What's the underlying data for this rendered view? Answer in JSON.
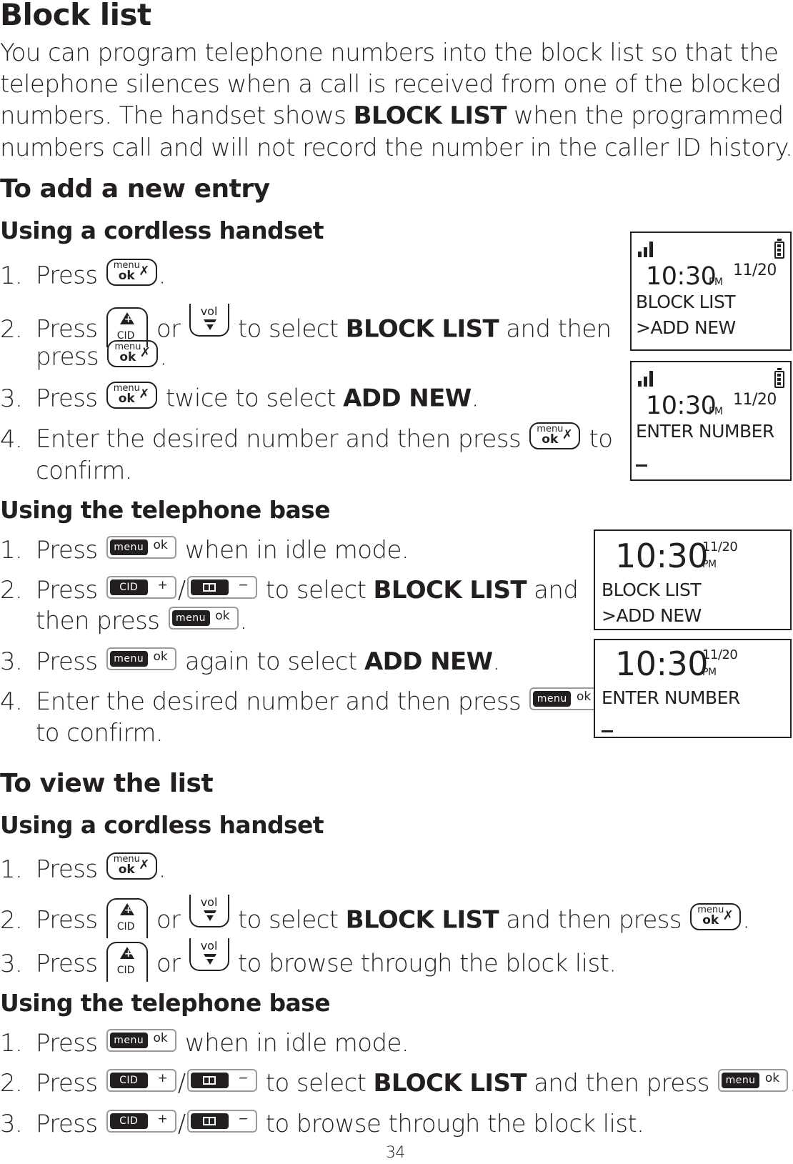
{
  "title": "Block list",
  "intro": [
    "You can program telephone numbers into the block list so that the",
    "telephone silences when a call is received from one of the blocked",
    "numbers. The handset shows ",
    "BLOCK LIST",
    " when the programmed",
    "numbers call and will not record the number in the caller ID history."
  ],
  "add_section": {
    "heading": "To add a new entry",
    "handset": {
      "heading": "Using a cordless handset",
      "steps": {
        "s1": {
          "num": "1.",
          "a": "Press ",
          "b": "."
        },
        "s2": {
          "num": "2.",
          "a": "Press ",
          "or": " or ",
          "c": " to select ",
          "bold": "BLOCK LIST",
          "d": " and then",
          "e": "press ",
          "f": "."
        },
        "s3": {
          "num": "3.",
          "a": "Press ",
          "b": " twice to select ",
          "bold": "ADD NEW",
          "c": "."
        },
        "s4": {
          "num": "4.",
          "a": "Enter the desired number and then press ",
          "b": " to",
          "c": "confirm."
        }
      }
    },
    "base": {
      "heading": "Using the telephone base",
      "steps": {
        "s1": {
          "num": "1.",
          "a": "Press ",
          "b": " when in idle mode."
        },
        "s2": {
          "num": "2.",
          "a": "Press ",
          "slash": "/",
          "c": " to select ",
          "bold": "BLOCK LIST",
          "d": " and",
          "e": "then press ",
          "f": "."
        },
        "s3": {
          "num": "3.",
          "a": "Press ",
          "b": " again to select ",
          "bold": "ADD NEW",
          "c": "."
        },
        "s4": {
          "num": "4.",
          "a": "Enter the desired number and then press ",
          "c": "to confirm."
        }
      }
    }
  },
  "view_section": {
    "heading": "To view the list",
    "handset": {
      "heading": "Using a cordless handset",
      "steps": {
        "s1": {
          "num": "1.",
          "a": "Press ",
          "b": "."
        },
        "s2": {
          "num": "2.",
          "a": "Press ",
          "or": " or ",
          "c": " to select ",
          "bold": "BLOCK LIST",
          "d": " and then press ",
          "f": "."
        },
        "s3": {
          "num": "3.",
          "a": "Press ",
          "or": " or ",
          "c": " to browse through the block list."
        }
      }
    },
    "base": {
      "heading": "Using the telephone base",
      "steps": {
        "s1": {
          "num": "1.",
          "a": "Press ",
          "b": " when in idle mode."
        },
        "s2": {
          "num": "2.",
          "a": "Press ",
          "slash": "/",
          "c": " to select ",
          "bold": "BLOCK LIST",
          "d": " and then press ",
          "f": "."
        },
        "s3": {
          "num": "3.",
          "a": "Press ",
          "slash": "/",
          "c": " to browse through the block list."
        }
      }
    }
  },
  "keys": {
    "menu": "menu",
    "ok": "ok",
    "cid": "CID",
    "vol": "vol",
    "plus": "+",
    "minus": "−",
    "mute_glyph": "✗"
  },
  "displays": {
    "handset_1": {
      "time": "10:30",
      "ampm": "PM",
      "date": "11/20",
      "line1": "BLOCK LIST",
      "line2": ">ADD NEW"
    },
    "handset_2": {
      "time": "10:30",
      "ampm": "PM",
      "date": "11/20",
      "line1": "ENTER NUMBER"
    },
    "base_1": {
      "time": "10:30",
      "ampm": "PM",
      "date": "11/20",
      "line1": "BLOCK LIST",
      "line2": ">ADD NEW"
    },
    "base_2": {
      "time": "10:30",
      "ampm": "PM",
      "date": "11/20",
      "line1": "ENTER NUMBER"
    }
  },
  "page_number": "34"
}
